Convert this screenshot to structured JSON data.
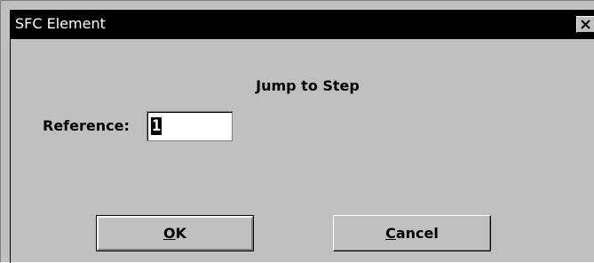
{
  "window": {
    "title": "SFC Element",
    "close_icon": "close-icon"
  },
  "dialog": {
    "heading": "Jump to Step",
    "reference_label": "Reference:",
    "reference_value": "1"
  },
  "buttons": {
    "ok": {
      "mnemonic": "O",
      "rest": "K"
    },
    "cancel": {
      "mnemonic": "C",
      "rest": "ancel"
    }
  },
  "colors": {
    "dialog_background": "#c0c0c0",
    "title_bar": "#000000",
    "title_text": "#ffffff",
    "input_background": "#ffffff"
  }
}
